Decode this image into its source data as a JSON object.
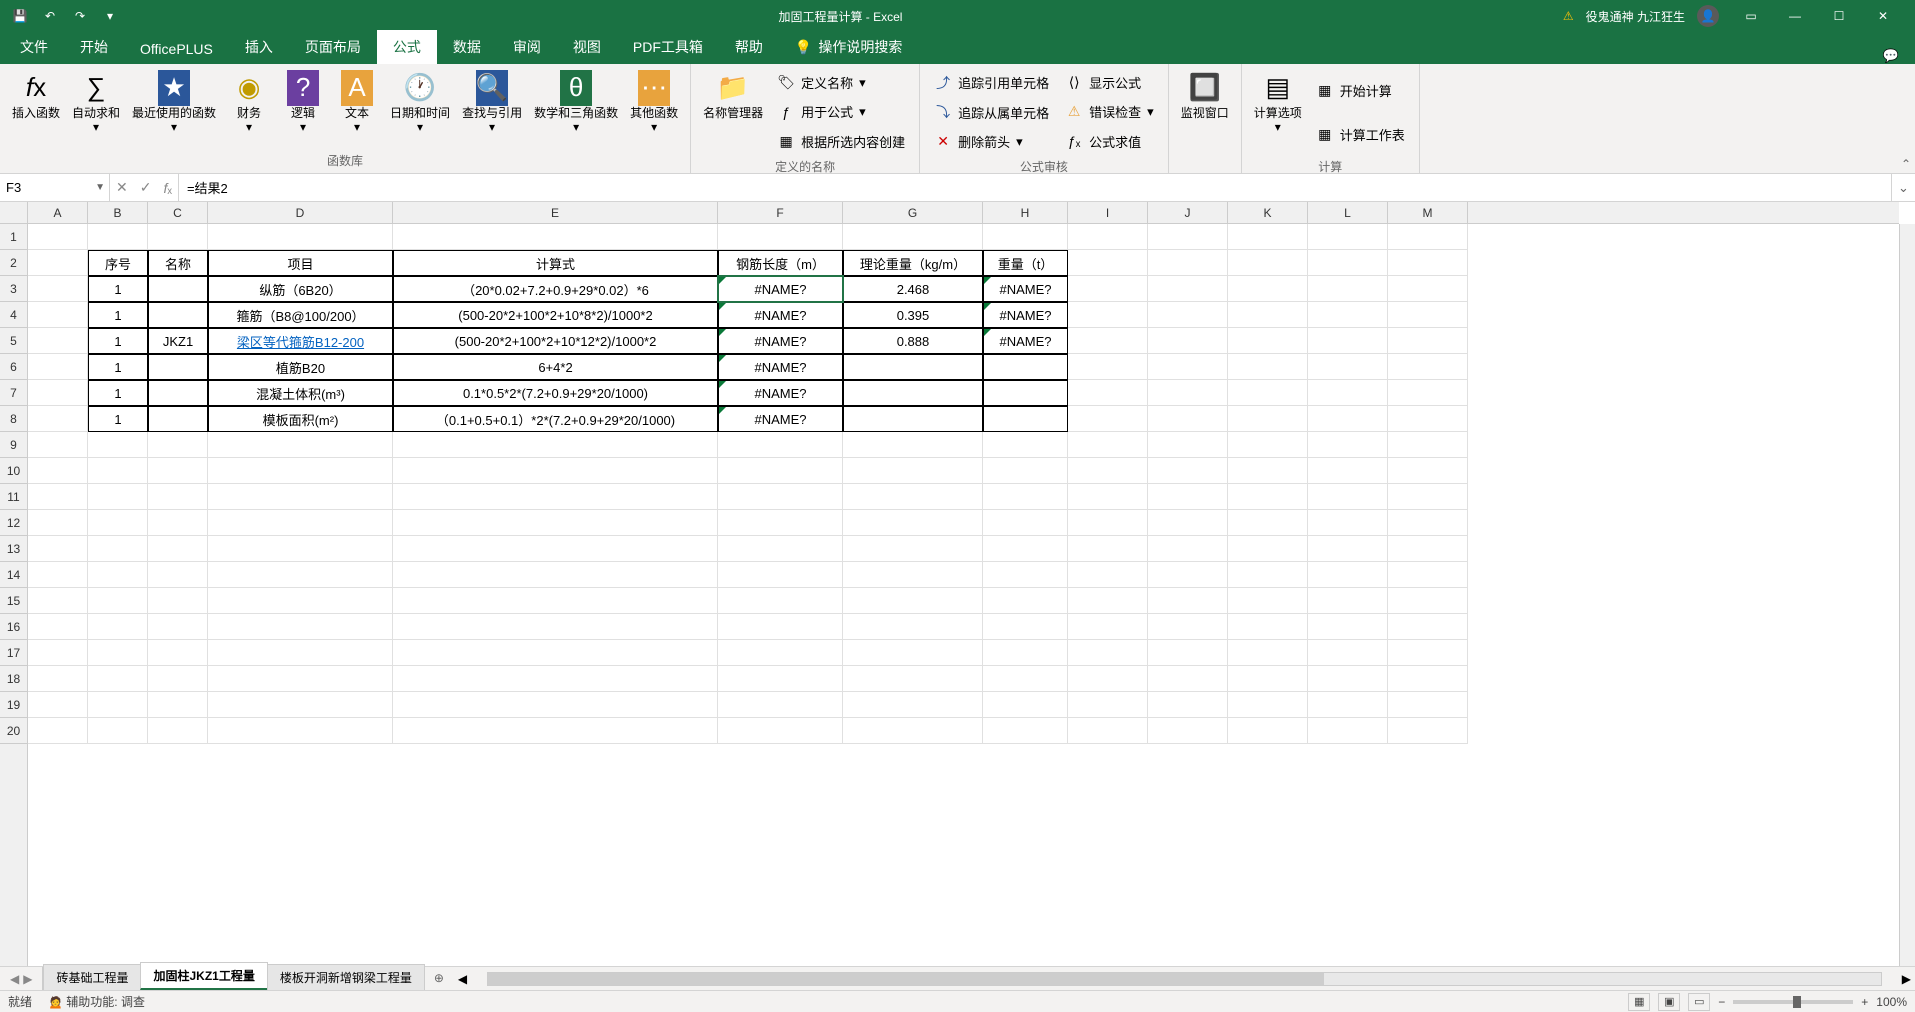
{
  "title_bar": {
    "app_title": "加固工程量计算 - Excel",
    "user_warning_label": "役鬼通神 九江狂生"
  },
  "ribbon_tabs": [
    "文件",
    "开始",
    "OfficePLUS",
    "插入",
    "页面布局",
    "公式",
    "数据",
    "审阅",
    "视图",
    "PDF工具箱",
    "帮助"
  ],
  "ribbon_active_tab": "公式",
  "ribbon_search_placeholder": "操作说明搜索",
  "ribbon_groups": {
    "insert_fn": "插入函数",
    "autosum": "自动求和",
    "recent": "最近使用的函数",
    "financial": "财务",
    "logical": "逻辑",
    "text": "文本",
    "datetime": "日期和时间",
    "lookup": "查找与引用",
    "mathtrig": "数学和三角函数",
    "other": "其他函数",
    "lib_label": "函数库",
    "name_mgr": "名称管理器",
    "define_name": "定义名称",
    "use_in_formula": "用于公式",
    "create_from_sel": "根据所选内容创建",
    "names_label": "定义的名称",
    "trace_prec": "追踪引用单元格",
    "trace_dep": "追踪从属单元格",
    "remove_arrows": "删除箭头",
    "show_formulas": "显示公式",
    "error_check": "错误检查",
    "eval_formula": "公式求值",
    "audit_label": "公式审核",
    "watch_window": "监视窗口",
    "calc_options": "计算选项",
    "calc_now": "开始计算",
    "calc_sheet": "计算工作表",
    "calc_label": "计算"
  },
  "name_box": "F3",
  "formula_bar_value": "=结果2",
  "columns": [
    "A",
    "B",
    "C",
    "D",
    "E",
    "F",
    "G",
    "H",
    "I",
    "J",
    "K",
    "L",
    "M"
  ],
  "row_count": 20,
  "table": {
    "headers": {
      "B": "序号",
      "C": "名称",
      "D": "项目",
      "E": "计算式",
      "F": "钢筋长度（m）",
      "G": "理论重量（kg/m）",
      "H": "重量（t）"
    },
    "merged_C": "JKZ1",
    "rows": [
      {
        "B": "1",
        "D": "纵筋（6B20）",
        "E": "（20*0.02+7.2+0.9+29*0.02）*6",
        "F": "#NAME?",
        "G": "2.468",
        "H": "#NAME?"
      },
      {
        "B": "1",
        "D": "箍筋（B8@100/200）",
        "E": "(500-20*2+100*2+10*8*2)/1000*2",
        "F": "#NAME?",
        "G": "0.395",
        "H": "#NAME?"
      },
      {
        "B": "1",
        "D": "梁区等代箍筋B12-200",
        "E": "(500-20*2+100*2+10*12*2)/1000*2",
        "F": "#NAME?",
        "G": "0.888",
        "H": "#NAME?",
        "link": true
      },
      {
        "B": "1",
        "D": "植筋B20",
        "E": "6+4*2",
        "F": "#NAME?",
        "G": "",
        "H": ""
      },
      {
        "B": "1",
        "D": "混凝土体积(m³)",
        "E": "0.1*0.5*2*(7.2+0.9+29*20/1000)",
        "F": "#NAME?",
        "G": "",
        "H": ""
      },
      {
        "B": "1",
        "D": "模板面积(m²)",
        "E": "（0.1+0.5+0.1）*2*(7.2+0.9+29*20/1000)",
        "F": "#NAME?",
        "G": "",
        "H": ""
      }
    ]
  },
  "sheet_tabs": [
    "砖基础工程量",
    "加固柱JKZ1工程量",
    "楼板开洞新增钢梁工程量"
  ],
  "active_sheet": 1,
  "status": {
    "ready": "就绪",
    "accessibility": "辅助功能: 调查",
    "zoom": "100%"
  }
}
